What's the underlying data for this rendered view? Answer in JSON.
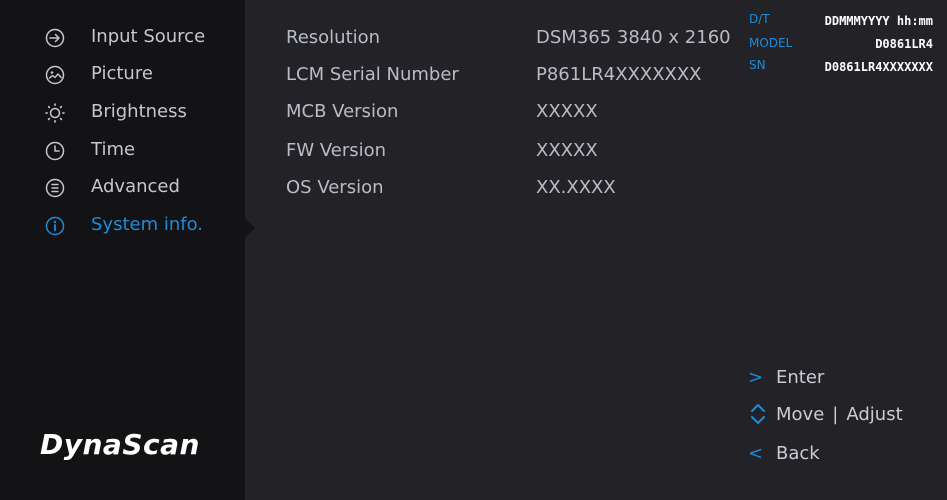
{
  "menu": {
    "items": [
      {
        "label": "Input Source",
        "icon": "input-source-icon"
      },
      {
        "label": "Picture",
        "icon": "picture-icon"
      },
      {
        "label": "Brightness",
        "icon": "brightness-icon"
      },
      {
        "label": "Time",
        "icon": "clock-icon"
      },
      {
        "label": "Advanced",
        "icon": "advanced-icon"
      },
      {
        "label": "System info.",
        "icon": "info-icon",
        "active": true
      }
    ]
  },
  "brand": {
    "logo_text": "DynaScan"
  },
  "status": {
    "dt_key": "D/T",
    "dt_value": "DDMMMYYYY hh:mm",
    "model_key": "MODEL",
    "model_value": "D0861LR4",
    "sn_key": "SN",
    "sn_value": "D0861LR4XXXXXXX"
  },
  "system_info": [
    {
      "label": "Resolution",
      "value": "DSM365  3840 x 2160"
    },
    {
      "label": "LCM Serial Number",
      "value": "P861LR4XXXXXXX"
    },
    {
      "label": "MCB Version",
      "value": "XXXXX"
    },
    {
      "label": "FW Version",
      "value": "XXXXX"
    },
    {
      "label": "OS Version",
      "value": "XX.XXXX"
    }
  ],
  "hints": {
    "enter": "Enter",
    "move": "Move",
    "separator": "|",
    "adjust": "Adjust",
    "back": "Back"
  },
  "colors": {
    "accent": "#1f8bd8",
    "sidebar_bg": "#131316",
    "panel_bg": "#232327"
  }
}
